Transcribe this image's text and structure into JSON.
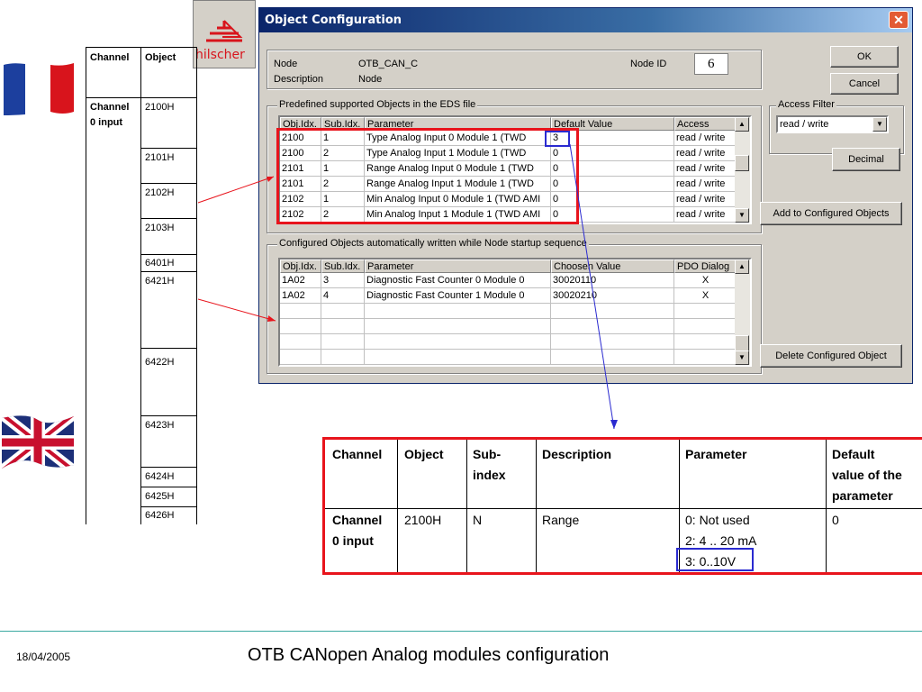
{
  "slide": {
    "date": "18/04/2005",
    "title": "OTB CANopen Analog modules configuration"
  },
  "flags": {
    "top": "france-flag",
    "bottom": "uk-flag"
  },
  "logo": {
    "text": "hilscher"
  },
  "left_table": {
    "headers": [
      "Channel",
      "Object"
    ],
    "channel_label": [
      "Channel",
      "0 input"
    ],
    "objects": [
      "2100H",
      "2101H",
      "2102H",
      "2103H",
      "6401H",
      "6421H",
      "6422H",
      "6423H",
      "6424H",
      "6425H",
      "6426H"
    ]
  },
  "dialog": {
    "title": "Object Configuration",
    "node_label": "Node",
    "node_value": "OTB_CAN_C",
    "node_id_label": "Node ID",
    "node_id_value": "6",
    "description_label": "Description",
    "description_value": "Node",
    "ok_label": "OK",
    "cancel_label": "Cancel",
    "access_filter_label": "Access Filter",
    "access_filter_value": "read / write",
    "decimal_label": "Decimal",
    "add_label": "Add to Configured Objects",
    "delete_label": "Delete Configured Object",
    "predefined": {
      "label": "Predefined supported Objects in the EDS file",
      "headers": [
        "Obj.Idx.",
        "Sub.Idx.",
        "Parameter",
        "Default Value",
        "Access"
      ],
      "rows": [
        [
          "2100",
          "1",
          "Type Analog Input 0 Module 1 (TWD",
          "3",
          "read / write"
        ],
        [
          "2100",
          "2",
          "Type Analog Input 1 Module 1 (TWD",
          "0",
          "read / write"
        ],
        [
          "2101",
          "1",
          "Range Analog Input 0 Module 1 (TWD",
          "0",
          "read / write"
        ],
        [
          "2101",
          "2",
          "Range Analog Input 1 Module 1 (TWD",
          "0",
          "read / write"
        ],
        [
          "2102",
          "1",
          "Min Analog Input 0 Module 1 (TWD AMI",
          "0",
          "read / write"
        ],
        [
          "2102",
          "2",
          "Min Analog Input 1 Module 1 (TWD AMI",
          "0",
          "read / write"
        ]
      ]
    },
    "configured": {
      "label": "Configured Objects automatically written while Node startup sequence",
      "headers": [
        "Obj.Idx.",
        "Sub.Idx.",
        "Parameter",
        "Choosen Value",
        "PDO Dialog"
      ],
      "rows": [
        [
          "1A02",
          "3",
          "Diagnostic Fast Counter 0 Module 0",
          "30020110",
          "X"
        ],
        [
          "1A02",
          "4",
          "Diagnostic Fast Counter 1 Module 0",
          "30020210",
          "X"
        ]
      ]
    }
  },
  "bottom_table": {
    "headers": [
      "Channel",
      "Object",
      "Sub-\nindex",
      "Description",
      "Parameter",
      "Default\nvalue of the\nparameter"
    ],
    "row": {
      "channel": "Channel\n0 input",
      "object": "2100H",
      "subindex": "N",
      "description": "Range",
      "parameter": [
        "0: Not used",
        "2: 4 .. 20 mA",
        "3: 0..10V"
      ],
      "default": "0"
    }
  },
  "colors": {
    "highlight_red": "#e8141c",
    "highlight_blue": "#2a2ad0",
    "footer_line": "#3aa8a0"
  }
}
